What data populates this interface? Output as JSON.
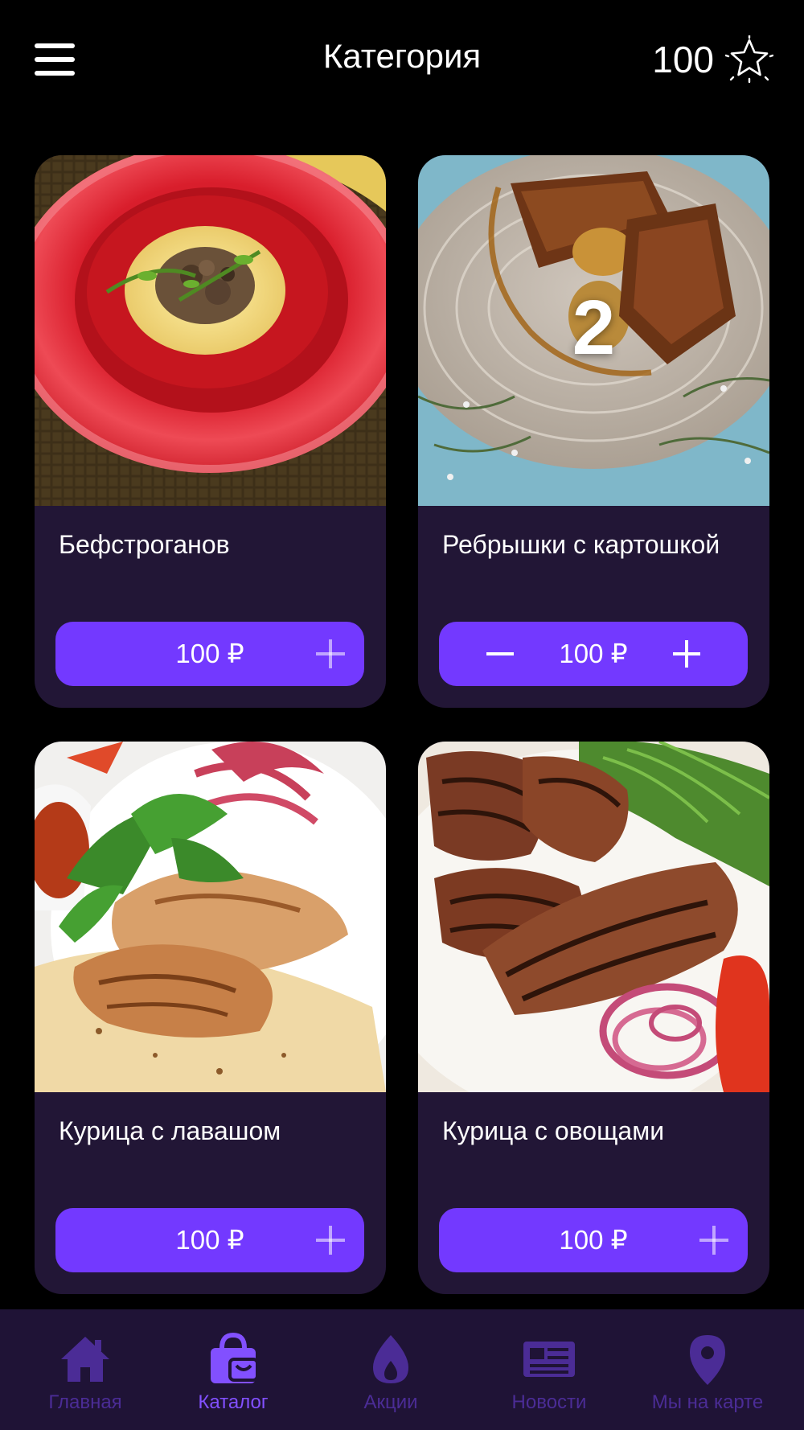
{
  "header": {
    "title": "Категория",
    "points": "100"
  },
  "products": [
    {
      "name": "Бефстроганов",
      "price": "100 ₽",
      "quantity": null
    },
    {
      "name": "Ребрышки с картошкой",
      "price": "100 ₽",
      "quantity": "2"
    },
    {
      "name": "Курица с лавашом",
      "price": "100 ₽",
      "quantity": null
    },
    {
      "name": "Курица с овощами",
      "price": "100 ₽",
      "quantity": null
    }
  ],
  "tabs": [
    {
      "label": "Главная",
      "icon": "home-icon",
      "active": false
    },
    {
      "label": "Каталог",
      "icon": "shopping-bag-icon",
      "active": true
    },
    {
      "label": "Акции",
      "icon": "flame-icon",
      "active": false
    },
    {
      "label": "Новости",
      "icon": "newspaper-icon",
      "active": false
    },
    {
      "label": "Мы на карте",
      "icon": "map-pin-icon",
      "active": false
    }
  ],
  "colors": {
    "background": "#000000",
    "card": "#221636",
    "accent": "#7339ff",
    "tabbar": "#1f1336",
    "tab_inactive": "#4b2c96",
    "tab_active": "#8250ff"
  }
}
